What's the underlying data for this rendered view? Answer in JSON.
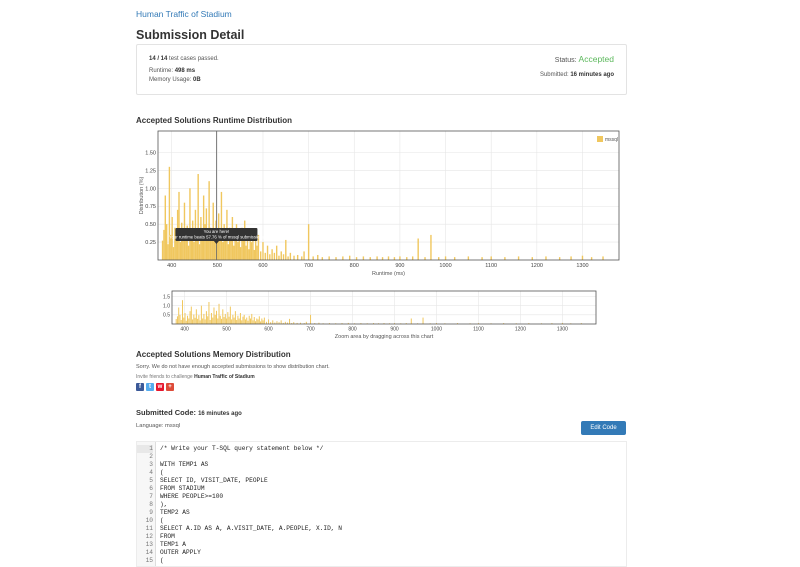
{
  "problem": {
    "link_text": "Human Traffic of Stadium"
  },
  "page_title": "Submission Detail",
  "detail": {
    "cases_passed": "14 / 14",
    "cases_suffix": " test cases passed.",
    "status_label": "Status:",
    "status_value": "Accepted",
    "runtime_label": "Runtime:",
    "runtime_value": "498 ms",
    "memory_label": "Memory Usage:",
    "memory_value": "0B",
    "submitted_label": "Submitted:",
    "submitted_value": "16 minutes ago"
  },
  "runtime_section": {
    "title": "Accepted Solutions Runtime Distribution"
  },
  "chart_data": [
    {
      "type": "bar",
      "xlabel": "Runtime (ms)",
      "ylabel": "Distribution (%)",
      "series": [
        {
          "name": "mssql",
          "color": "#f0c75e"
        }
      ],
      "xlim": [
        370,
        1380
      ],
      "ylim": [
        0,
        1.8
      ],
      "x_ticks": [
        "400",
        "500",
        "600",
        "700",
        "800",
        "900",
        "1000",
        "1100",
        "1200",
        "1300"
      ],
      "y_ticks": [
        "0.25",
        "0.50",
        "0.75",
        "1.00",
        "1.25",
        "1.50"
      ],
      "marker_x": 498,
      "tooltip": {
        "title": "You are here!",
        "text": "Your runtime beats 57.76 % of mssql submissions"
      },
      "bars": [
        [
          380,
          0.27
        ],
        [
          383,
          0.42
        ],
        [
          386,
          0.9
        ],
        [
          389,
          0.5
        ],
        [
          392,
          0.22
        ],
        [
          395,
          1.3
        ],
        [
          398,
          0.35
        ],
        [
          401,
          0.6
        ],
        [
          404,
          0.18
        ],
        [
          407,
          0.45
        ],
        [
          410,
          0.3
        ],
        [
          413,
          0.7
        ],
        [
          416,
          0.95
        ],
        [
          419,
          0.25
        ],
        [
          422,
          0.52
        ],
        [
          425,
          0.34
        ],
        [
          428,
          0.8
        ],
        [
          431,
          0.28
        ],
        [
          434,
          0.48
        ],
        [
          437,
          0.2
        ],
        [
          440,
          1.0
        ],
        [
          443,
          0.3
        ],
        [
          446,
          0.55
        ],
        [
          449,
          0.25
        ],
        [
          452,
          0.7
        ],
        [
          455,
          0.42
        ],
        [
          458,
          1.2
        ],
        [
          461,
          0.22
        ],
        [
          464,
          0.6
        ],
        [
          467,
          0.35
        ],
        [
          470,
          0.9
        ],
        [
          473,
          0.5
        ],
        [
          476,
          0.72
        ],
        [
          479,
          0.3
        ],
        [
          482,
          1.1
        ],
        [
          485,
          0.45
        ],
        [
          488,
          0.28
        ],
        [
          491,
          0.8
        ],
        [
          494,
          0.38
        ],
        [
          497,
          0.55
        ],
        [
          500,
          0.3
        ],
        [
          503,
          0.65
        ],
        [
          506,
          0.4
        ],
        [
          509,
          0.95
        ],
        [
          512,
          0.25
        ],
        [
          515,
          0.5
        ],
        [
          518,
          0.35
        ],
        [
          521,
          0.7
        ],
        [
          524,
          0.22
        ],
        [
          527,
          0.45
        ],
        [
          530,
          0.3
        ],
        [
          533,
          0.6
        ],
        [
          536,
          0.2
        ],
        [
          539,
          0.4
        ],
        [
          542,
          0.5
        ],
        [
          545,
          0.25
        ],
        [
          548,
          0.35
        ],
        [
          551,
          0.18
        ],
        [
          554,
          0.45
        ],
        [
          557,
          0.3
        ],
        [
          560,
          0.55
        ],
        [
          563,
          0.2
        ],
        [
          566,
          0.38
        ],
        [
          569,
          0.15
        ],
        [
          572,
          0.3
        ],
        [
          575,
          0.25
        ],
        [
          578,
          0.42
        ],
        [
          581,
          0.14
        ],
        [
          584,
          0.3
        ],
        [
          587,
          0.2
        ],
        [
          590,
          0.35
        ],
        [
          595,
          0.12
        ],
        [
          600,
          0.25
        ],
        [
          605,
          0.1
        ],
        [
          610,
          0.2
        ],
        [
          615,
          0.08
        ],
        [
          620,
          0.15
        ],
        [
          625,
          0.1
        ],
        [
          630,
          0.2
        ],
        [
          635,
          0.06
        ],
        [
          640,
          0.12
        ],
        [
          645,
          0.08
        ],
        [
          650,
          0.28
        ],
        [
          655,
          0.05
        ],
        [
          660,
          0.1
        ],
        [
          668,
          0.06
        ],
        [
          676,
          0.07
        ],
        [
          685,
          0.05
        ],
        [
          690,
          0.12
        ],
        [
          700,
          0.5
        ],
        [
          710,
          0.05
        ],
        [
          720,
          0.07
        ],
        [
          730,
          0.04
        ],
        [
          745,
          0.05
        ],
        [
          760,
          0.04
        ],
        [
          775,
          0.05
        ],
        [
          790,
          0.06
        ],
        [
          805,
          0.04
        ],
        [
          820,
          0.05
        ],
        [
          835,
          0.04
        ],
        [
          850,
          0.05
        ],
        [
          862,
          0.04
        ],
        [
          875,
          0.05
        ],
        [
          888,
          0.04
        ],
        [
          900,
          0.05
        ],
        [
          915,
          0.04
        ],
        [
          928,
          0.05
        ],
        [
          940,
          0.3
        ],
        [
          955,
          0.04
        ],
        [
          968,
          0.35
        ],
        [
          985,
          0.04
        ],
        [
          1000,
          0.05
        ],
        [
          1020,
          0.04
        ],
        [
          1050,
          0.05
        ],
        [
          1080,
          0.04
        ],
        [
          1100,
          0.05
        ],
        [
          1130,
          0.04
        ],
        [
          1160,
          0.05
        ],
        [
          1190,
          0.04
        ],
        [
          1220,
          0.05
        ],
        [
          1250,
          0.04
        ],
        [
          1275,
          0.05
        ],
        [
          1300,
          0.06
        ],
        [
          1320,
          0.04
        ],
        [
          1345,
          0.05
        ]
      ]
    },
    {
      "type": "bar",
      "xlabel": "Zoom area by dragging across this chart",
      "xlim": [
        370,
        1380
      ],
      "ylim": [
        0,
        1.8
      ],
      "x_ticks": [
        "400",
        "500",
        "600",
        "700",
        "800",
        "900",
        "1000",
        "1100",
        "1200",
        "1300"
      ],
      "y_ticks": [
        "0.5",
        "1.0",
        "1.5"
      ]
    }
  ],
  "memory_section": {
    "title": "Accepted Solutions Memory Distribution",
    "message": "Sorry. We do not have enough accepted submissions to show distribution chart.",
    "invite_prefix": "Invite friends to challenge ",
    "invite_problem": "Human Traffic of Stadium"
  },
  "share": [
    {
      "label": "f",
      "color": "#3b5998"
    },
    {
      "label": "t",
      "color": "#55acee"
    },
    {
      "label": "w",
      "color": "#e6162d"
    },
    {
      "label": "+",
      "color": "#dd4b39"
    }
  ],
  "code_section": {
    "title": "Submitted Code:",
    "time": "16 minutes ago",
    "language_label": "Language:",
    "language_value": "mssql",
    "edit_label": "Edit Code",
    "lines": [
      "/* Write your T-SQL query statement below */",
      "",
      "WITH TEMP1 AS",
      "(",
      "SELECT ID, VISIT_DATE, PEOPLE",
      "FROM STADIUM",
      "WHERE PEOPLE>=100",
      "),",
      "TEMP2 AS",
      "(",
      "SELECT A.ID AS A, A.VISIT_DATE, A.PEOPLE, X.ID, N",
      "FROM",
      "TEMP1 A",
      "OUTER APPLY",
      "("
    ]
  }
}
